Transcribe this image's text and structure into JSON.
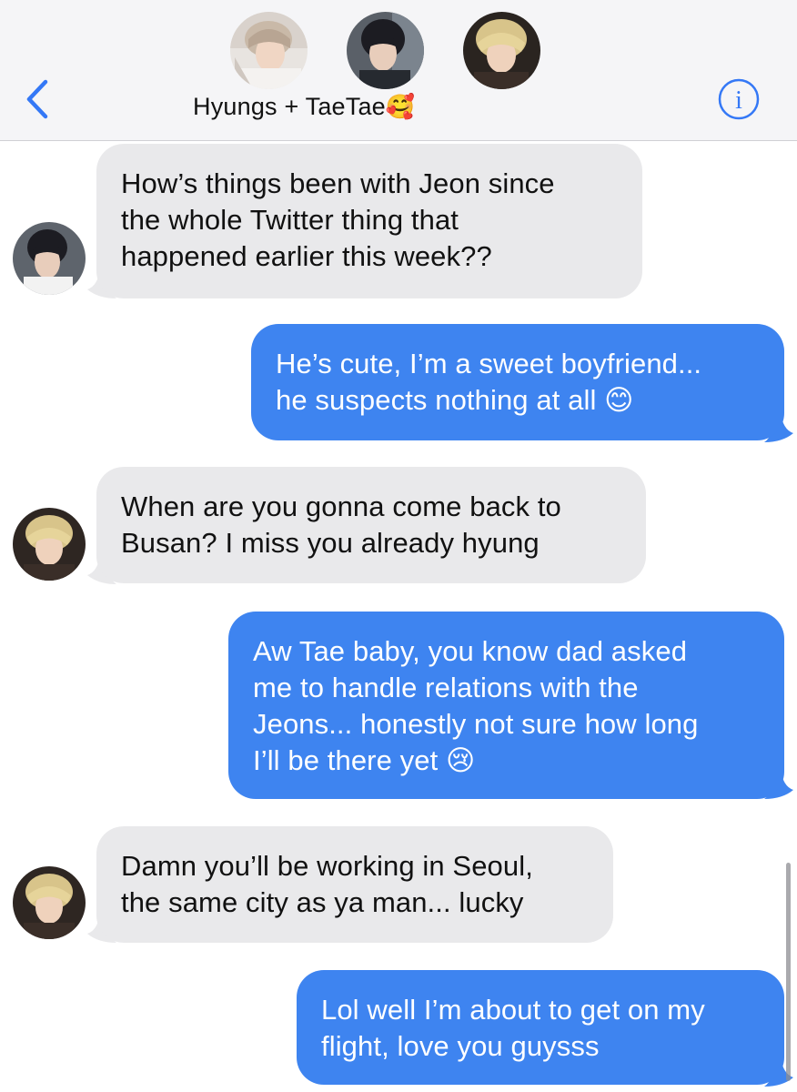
{
  "header": {
    "group_name": "Hyungs + TaeTae",
    "group_emoji": "🥰",
    "back_icon": "chevron-left-icon",
    "info_icon": "info-circle-icon",
    "accent_color": "#3478f6",
    "avatars": [
      "avatar-member-1",
      "avatar-member-2",
      "avatar-member-3"
    ]
  },
  "messages": [
    {
      "direction": "incoming",
      "sender_avatar": "avatar-member-2",
      "lines": [
        "How’s things been with Jeon since",
        "the whole Twitter thing that",
        "happened earlier this week??"
      ]
    },
    {
      "direction": "outgoing",
      "lines": [
        "He’s cute, I’m a sweet boyfriend...",
        "he suspects nothing at all 😊"
      ]
    },
    {
      "direction": "incoming",
      "sender_avatar": "avatar-member-3",
      "lines": [
        "When are you gonna come back to",
        "Busan? I miss you already hyung"
      ]
    },
    {
      "direction": "outgoing",
      "lines": [
        "Aw Tae baby, you know dad asked",
        "me to handle relations with the",
        "Jeons... honestly not sure how long",
        "I’ll be there yet 😢"
      ]
    },
    {
      "direction": "incoming",
      "sender_avatar": "avatar-member-3",
      "lines": [
        "Damn you’ll be working in Seoul,",
        "the same city as ya man... lucky"
      ]
    },
    {
      "direction": "outgoing",
      "lines": [
        "Lol well I’m about to get on my",
        "flight, love you guysss"
      ]
    }
  ],
  "colors": {
    "incoming_bubble": "#e9e9eb",
    "outgoing_bubble": "#3e84f0",
    "header_bg": "#f5f5f7"
  }
}
